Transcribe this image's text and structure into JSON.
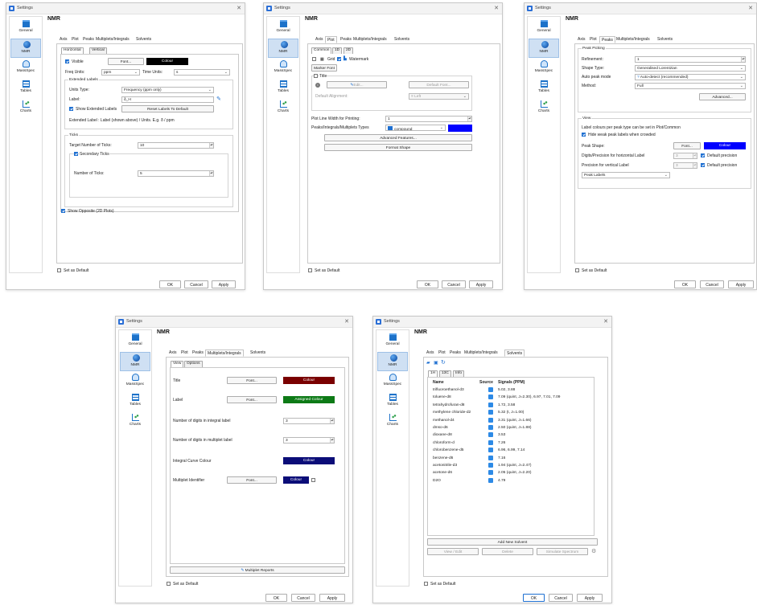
{
  "window_title": "Settings",
  "section_title": "NMR",
  "sidebar": [
    "General",
    "NMR",
    "MassSpec",
    "Tables",
    "Charts"
  ],
  "main_tabs": [
    "Axis",
    "Plot",
    "Peaks",
    "Multiplets/Integrals",
    "Solvents"
  ],
  "footer": {
    "set_default": "Set as Default",
    "ok": "OK",
    "cancel": "Cancel",
    "apply": "Apply"
  },
  "w1": {
    "subtabs": [
      "Horizontal",
      "Vertical"
    ],
    "visible": "Visible",
    "font": "Font...",
    "colour": "Colour",
    "freq_units_label": "Freq Units:",
    "freq_units_value": "ppm",
    "time_units_label": "Time Units:",
    "time_units_value": "s",
    "ext_group": "Extended Labels",
    "units_type_label": "Units Type:",
    "units_type_value": "Frequency (ppm only)",
    "label_label": "Label:",
    "label_value": "δ_H",
    "show_ext": "Show Extended Labels",
    "reset_labels": "Reset Labels To Default",
    "ext_label_text": "Extended Label : Label (shown above) / Units. E.g. δ / ppm",
    "ticks_group": "Ticks",
    "target_ticks_label": "Target Number of Ticks:",
    "target_ticks_value": "10",
    "secondary_ticks": "Secondary Ticks",
    "num_ticks_label": "Number of Ticks:",
    "num_ticks_value": "5",
    "show_opposite": "Show Opposite (2D Plots)"
  },
  "w2": {
    "subtabs": [
      "Common",
      "1D",
      "2D"
    ],
    "grid": "Grid",
    "watermark": "Watermark",
    "marker_font": "Marker Font",
    "title": "Title",
    "edit": "Edit...",
    "default_font": "Default Font...",
    "default_alignment": "Default Alignment:",
    "alignment_value": "Left",
    "line_width_label": "Plot Line Width for Printing:",
    "line_width_value": "1",
    "peaks_type_label": "Peaks/Integrals/Multiplets Types",
    "peaks_type_value": "compound",
    "advanced_features": "Advanced Features...",
    "format_shape": "Format Shape"
  },
  "w3": {
    "peak_picking": "Peak Picking",
    "refinement_label": "Refinement:",
    "refinement_value": "1",
    "shape_label": "Shape Type:",
    "shape_value": "Generalised Lorentzian",
    "auto_label": "Auto peak mode",
    "auto_value": "Auto-detect (recommended)",
    "method_label": "Method:",
    "method_value": "Full",
    "advanced": "Advanced...",
    "view": "View",
    "colour_note": "Label colours per peak type can be set in Plot/Common",
    "hide_weak": "Hide weak peak labels when crowded",
    "peak_shape_label": "Peak Shape:",
    "peak_shape_font": "Font...",
    "peak_shape_colour": "Colour",
    "digits_h_label": "Digits/Precision for horizontal Label",
    "digits_h_value": "3",
    "default_precision": "Default precision",
    "prec_v_label": "Precision for vertical Label",
    "prec_v_value": "3",
    "peak_labels": "Peak Labels"
  },
  "w4": {
    "subtabs": [
      "View",
      "Options"
    ],
    "title_label": "Title",
    "label_label": "Label",
    "font": "Font...",
    "colour": "Colour",
    "assigned_colour": "Assigned Colour",
    "int_digits_label": "Number of digits in integral label",
    "int_digits_value": "3",
    "mult_digits_label": "Number of digits in multiplet label",
    "mult_digits_value": "3",
    "curve_colour_label": "Integral Curve Colour",
    "mult_id_label": "Multiplet Identifier",
    "multiplet_reports": "Multiplet Reports"
  },
  "w5": {
    "subtabs": [
      "1H",
      "13C",
      "Info"
    ],
    "headers": [
      "Name",
      "Source",
      "Signals (PPM)"
    ],
    "rows": [
      {
        "name": "trifluoroethanol-d3",
        "sig": "5.02, 3.88"
      },
      {
        "name": "toluene-d8",
        "sig": "7.09 (quint, J=2.30), 6.97, 7.01, 7.09"
      },
      {
        "name": "tetrahydrofuran-d8",
        "sig": "1.72, 3.58"
      },
      {
        "name": "methylene chloride-d2",
        "sig": "5.32 (t, J=1.00)"
      },
      {
        "name": "methanol-d4",
        "sig": "3.31 (quint, J=1.66)"
      },
      {
        "name": "dmso-d6",
        "sig": "2.50 (quint, J=1.88)"
      },
      {
        "name": "dioxane-d8",
        "sig": "3.53"
      },
      {
        "name": "chloroform-d",
        "sig": "7.26"
      },
      {
        "name": "chlorobenzene-d5",
        "sig": "6.96, 6.99, 7.14"
      },
      {
        "name": "benzene-d6",
        "sig": "7.16"
      },
      {
        "name": "acetonitrile-d3",
        "sig": "1.94 (quint, J=2.47)"
      },
      {
        "name": "acetone-d6",
        "sig": "2.05 (quint, J=2.20)"
      },
      {
        "name": "D2O",
        "sig": "4.79"
      }
    ],
    "add_new": "Add New Solvent",
    "view_edit": "View / Edit",
    "delete": "Delete",
    "simulate": "Simulate Spectrum"
  },
  "colors": {
    "black": "#000000",
    "blue": "#0000ff",
    "darkred": "#7a0000",
    "green": "#0d7a16",
    "navy": "#0b0d78"
  }
}
